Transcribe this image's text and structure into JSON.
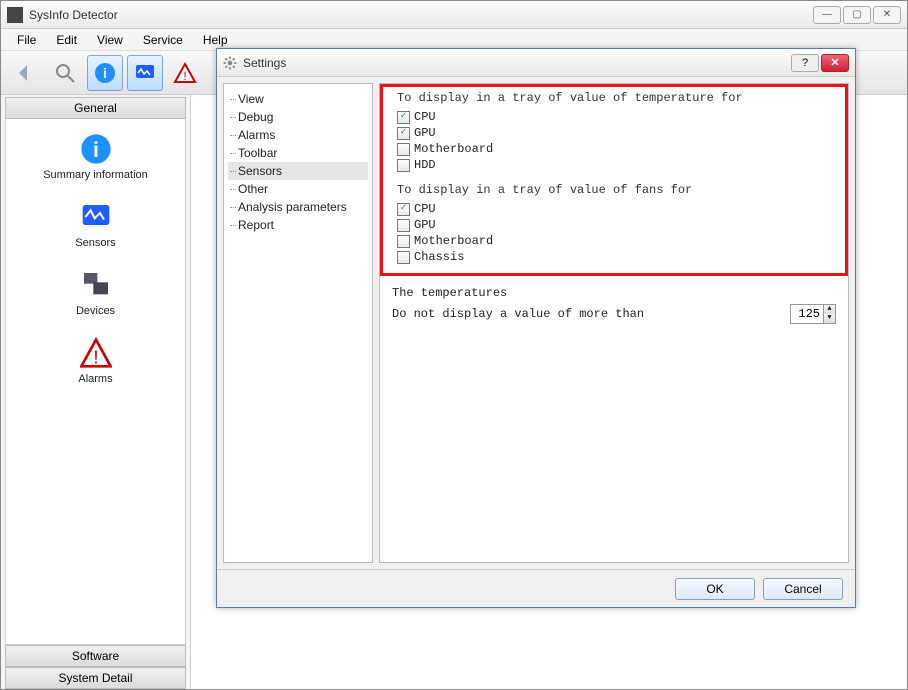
{
  "window": {
    "title": "SysInfo Detector"
  },
  "menu": {
    "file": "File",
    "edit": "Edit",
    "view": "View",
    "service": "Service",
    "help": "Help"
  },
  "leftPanel": {
    "tabs": {
      "general": "General",
      "software": "Software",
      "systemDetail": "System Detail"
    },
    "items": [
      {
        "label": "Summary information"
      },
      {
        "label": "Sensors"
      },
      {
        "label": "Devices"
      },
      {
        "label": "Alarms"
      }
    ]
  },
  "dialog": {
    "title": "Settings",
    "tree": [
      "View",
      "Debug",
      "Alarms",
      "Toolbar",
      "Sensors",
      "Other",
      "Analysis parameters",
      "Report"
    ],
    "selected": "Sensors",
    "section1": {
      "heading": "To display in a tray of value of temperature for",
      "items": [
        {
          "label": "CPU",
          "checked": true
        },
        {
          "label": "GPU",
          "checked": true
        },
        {
          "label": "Motherboard",
          "checked": false
        },
        {
          "label": "HDD",
          "checked": false
        }
      ]
    },
    "section2": {
      "heading": "To display in a tray of value of fans for",
      "items": [
        {
          "label": "CPU",
          "checked": true
        },
        {
          "label": "GPU",
          "checked": false
        },
        {
          "label": "Motherboard",
          "checked": false
        },
        {
          "label": "Chassis",
          "checked": false
        }
      ]
    },
    "temps": {
      "heading": "The temperatures",
      "maxLabel": "Do not display a value of more than",
      "maxValue": "125"
    },
    "buttons": {
      "ok": "OK",
      "cancel": "Cancel"
    }
  }
}
